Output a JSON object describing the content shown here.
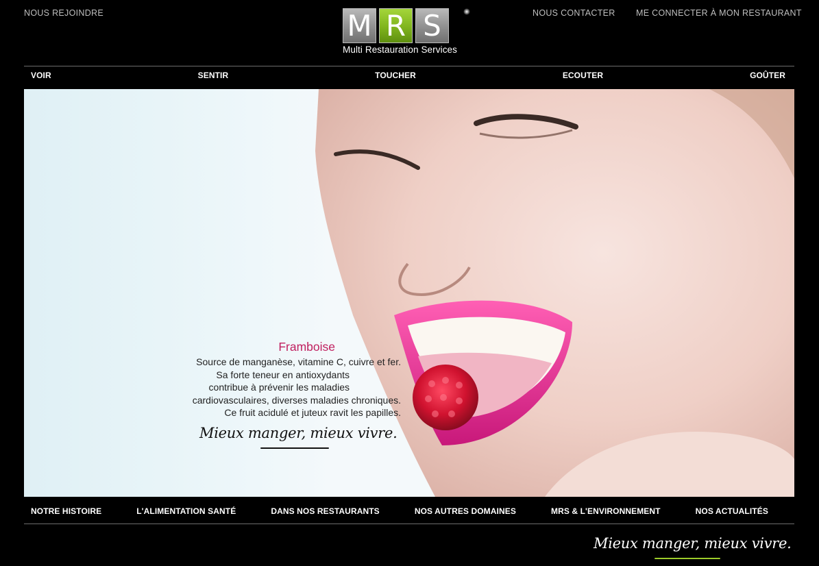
{
  "header": {
    "join_label": "NOUS REJOINDRE",
    "contact_label": "NOUS CONTACTER",
    "login_label": "ME CONNECTER À MON RESTAURANT"
  },
  "logo": {
    "letters": [
      "M",
      "R",
      "S"
    ],
    "subtitle": "Multi Restauration Services",
    "colors": {
      "grey_tile": "#8f8f8f",
      "green_tile": "#7fb41d"
    }
  },
  "senses_nav": {
    "items": [
      "VOIR",
      "SENTIR",
      "TOUCHER",
      "ECOUTER",
      "GOÛTER"
    ]
  },
  "hero": {
    "title": "Framboise",
    "lines": [
      "Source de manganèse, vitamine C, cuivre et fer.",
      "Sa forte teneur en antioxydants",
      "contribue à prévenir les maladies",
      "cardiovasculaires, diverses maladies chroniques.",
      "Ce fruit acidulé et juteux ravit les papilles."
    ],
    "slogan": "Mieux manger, mieux vivre.",
    "title_color": "#c0205f"
  },
  "main_nav": {
    "items": [
      "NOTRE HISTOIRE",
      "L'ALIMENTATION SANTÉ",
      "DANS NOS RESTAURANTS",
      "NOS AUTRES DOMAINES",
      "MRS & L'ENVIRONNEMENT",
      "NOS ACTUALITÉS"
    ]
  },
  "footer": {
    "slogan": "Mieux manger, mieux vivre.",
    "accent_color": "#9ccc2a"
  }
}
